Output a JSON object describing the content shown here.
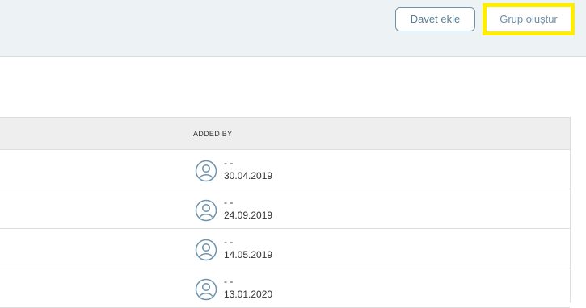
{
  "header": {
    "invite_button": "Davet ekle",
    "create_group_button": "Grup oluştur"
  },
  "table": {
    "columns": {
      "added_by": "ADDED BY"
    },
    "rows": [
      {
        "name": "- -",
        "date": "30.04.2019"
      },
      {
        "name": "- -",
        "date": "24.09.2019"
      },
      {
        "name": "- -",
        "date": "14.05.2019"
      },
      {
        "name": "- -",
        "date": "13.01.2020"
      }
    ]
  },
  "icons": {
    "avatar": "user-circle-icon"
  },
  "colors": {
    "highlight": "#ffee00",
    "accent": "#6f93ab",
    "header_band": "#edf2f5"
  }
}
